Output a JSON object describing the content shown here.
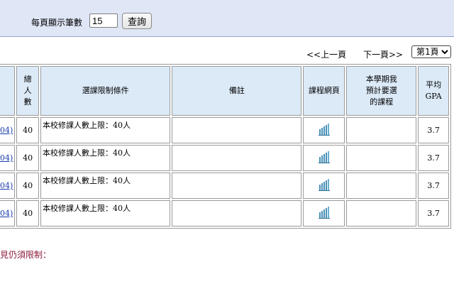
{
  "query_panel": {
    "per_page_label": "每頁顯示筆數",
    "per_page_value": "15",
    "query_button": "查詢"
  },
  "pagination": {
    "prev": "<<上一頁",
    "next": "下一頁>>",
    "page_selected": "第1頁"
  },
  "table": {
    "headers": {
      "total": "總人數",
      "limit": "選課限制條件",
      "remarks": "備註",
      "webpage": "課程網頁",
      "planned": "本學期我預計要選的課程",
      "gpa": "平均GPA"
    },
    "rows": [
      {
        "code": "04)",
        "total": "40",
        "limit": "本校修課人數上限：40人",
        "remarks": "",
        "planned": "",
        "gpa": "3.7"
      },
      {
        "code": "04)",
        "total": "40",
        "limit": "本校修課人數上限：40人",
        "remarks": "",
        "planned": "",
        "gpa": "3.7"
      },
      {
        "code": "04)",
        "total": "40",
        "limit": "本校修課人數上限：40人",
        "remarks": "",
        "planned": "",
        "gpa": "3.7"
      },
      {
        "code": "04)",
        "total": "40",
        "limit": "本校修課人數上限：40人",
        "remarks": "",
        "planned": "",
        "gpa": "3.7"
      }
    ]
  },
  "footer_note": "見仍須限制：",
  "icons": {
    "webpage": "bar-chart-icon"
  },
  "colors": {
    "panel_bg": "#dfe6f6",
    "header_bg": "#dceaf8",
    "link": "#1a3fb0",
    "note": "#8b1a3a",
    "icon": "#4a90b8"
  }
}
